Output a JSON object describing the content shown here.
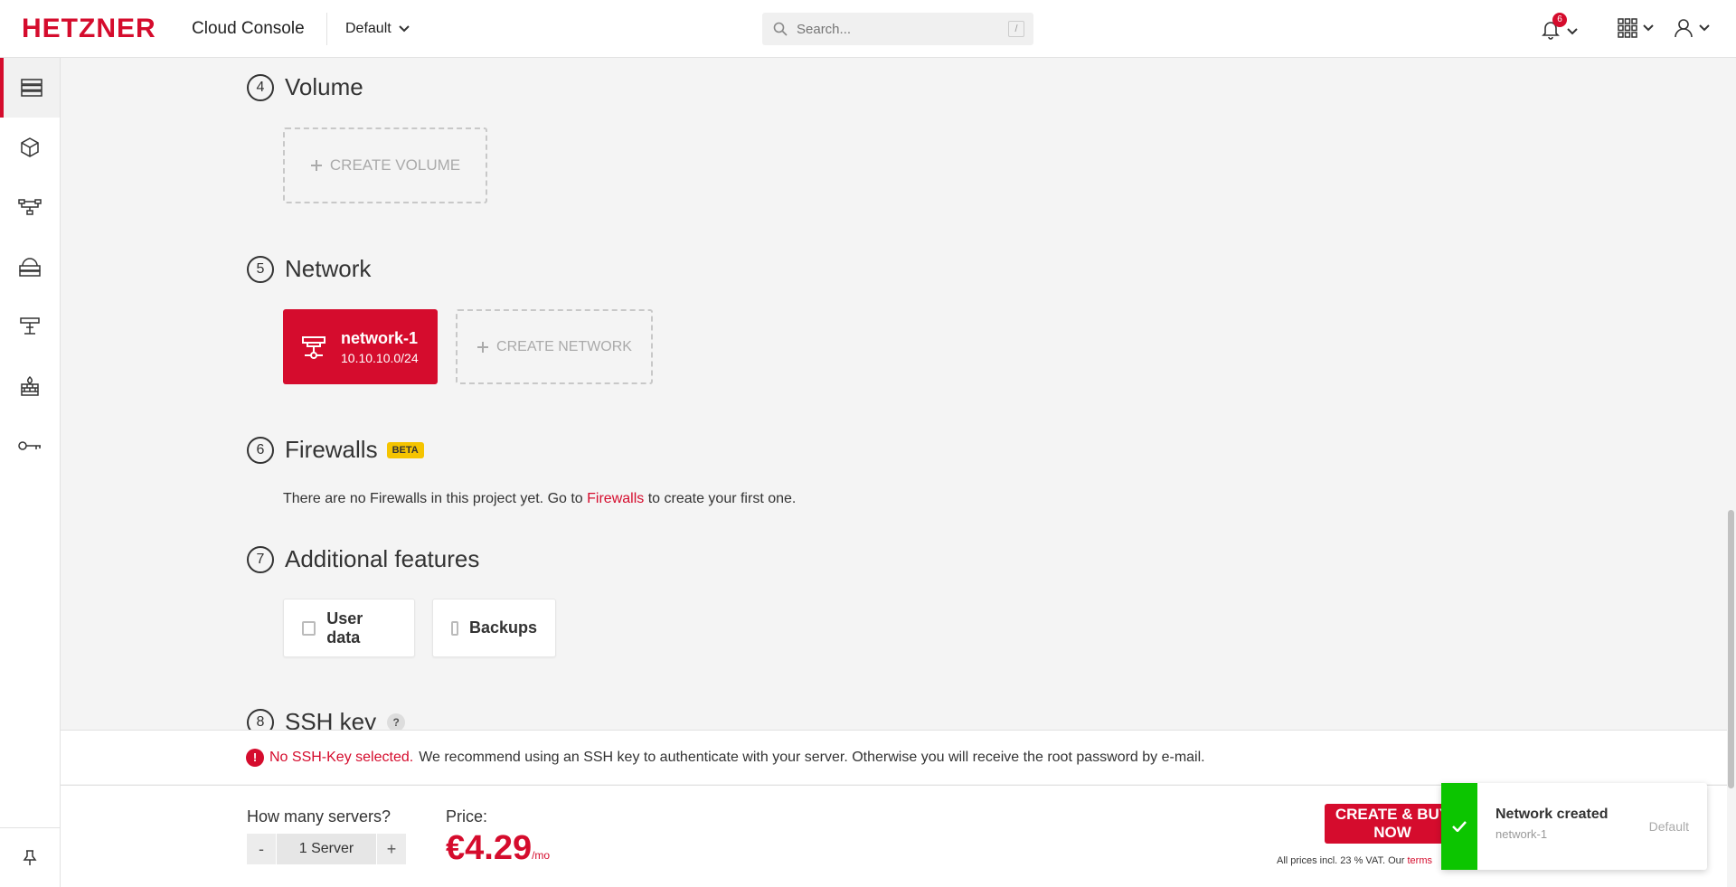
{
  "header": {
    "logo": "HETZNER",
    "app_title": "Cloud Console",
    "project": "Default",
    "search_placeholder": "Search...",
    "search_shortcut": "/",
    "notification_count": "6"
  },
  "sidebar": {
    "items": [
      {
        "icon": "servers-icon",
        "active": true
      },
      {
        "icon": "cube-icon"
      },
      {
        "icon": "network-icon"
      },
      {
        "icon": "load-balancer-icon"
      },
      {
        "icon": "floating-ip-icon"
      },
      {
        "icon": "firewall-icon"
      },
      {
        "icon": "key-icon"
      }
    ],
    "bottom_icon": "pin-icon"
  },
  "sections": {
    "volume": {
      "number": "4",
      "title": "Volume",
      "create_label": "CREATE VOLUME"
    },
    "network": {
      "number": "5",
      "title": "Network",
      "create_label": "CREATE NETWORK",
      "selected": {
        "name": "network-1",
        "cidr": "10.10.10.0/24"
      }
    },
    "firewalls": {
      "number": "6",
      "title": "Firewalls",
      "badge": "BETA",
      "text_before": "There are no Firewalls in this project yet. Go to ",
      "link": "Firewalls",
      "text_after": " to create your first one."
    },
    "features": {
      "number": "7",
      "title": "Additional features",
      "options": [
        {
          "label": "User data",
          "checked": false
        },
        {
          "label": "Backups",
          "checked": false
        }
      ]
    },
    "ssh": {
      "number": "8",
      "title": "SSH key",
      "help": "?"
    }
  },
  "warning": {
    "strong": "No SSH-Key selected.",
    "text": "We recommend using an SSH key to authenticate with your server. Otherwise you will receive the root password by e-mail."
  },
  "order": {
    "count_label": "How many servers?",
    "minus": "-",
    "count_value": "1 Server",
    "plus": "+",
    "price_label": "Price:",
    "price": "€4.29",
    "period": "/mo",
    "buy_label": "CREATE & BUY NOW",
    "vat_text": "All prices incl. 23 % VAT. Our ",
    "vat_link": "terms"
  },
  "toast": {
    "title": "Network created",
    "subtitle": "network-1",
    "project": "Default",
    "accent": "#0cc500"
  },
  "colors": {
    "brand": "#d50c2d",
    "beta": "#f5c400"
  }
}
